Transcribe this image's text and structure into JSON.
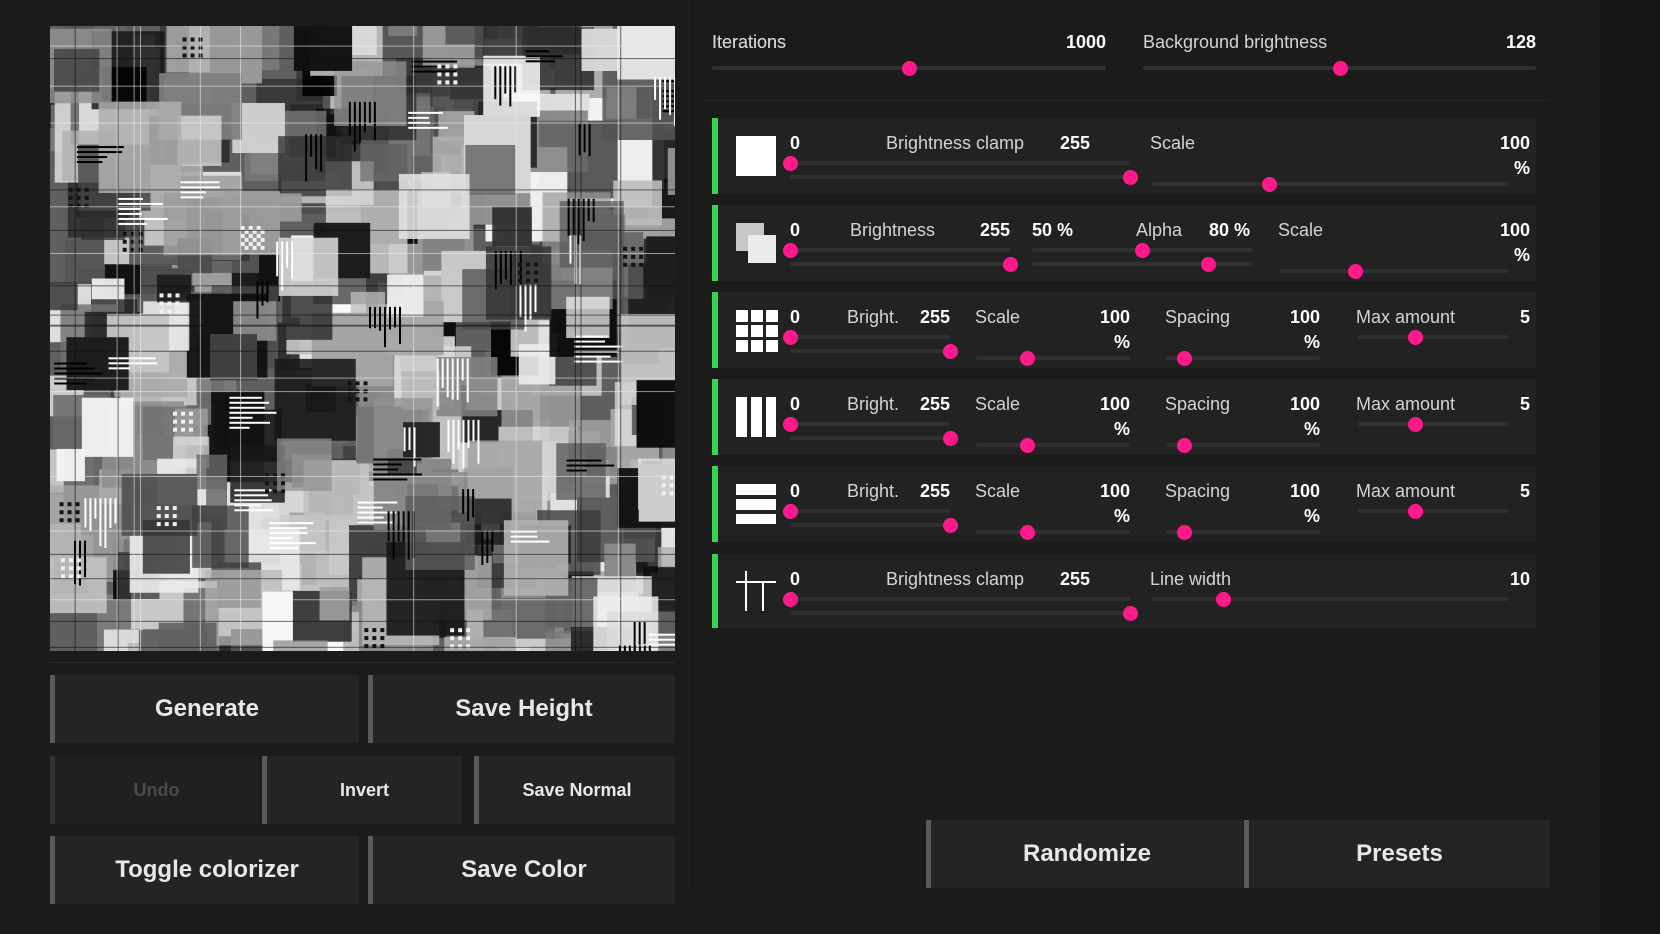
{
  "left_panel": {
    "buttons": {
      "generate": "Generate",
      "save_height": "Save Height",
      "undo": "Undo",
      "invert": "Invert",
      "save_normal": "Save Normal",
      "toggle_colorizer": "Toggle colorizer",
      "save_color": "Save Color"
    }
  },
  "top_settings": {
    "iterations": {
      "label": "Iterations",
      "value": "1000",
      "slider_fraction": 0.5
    },
    "background_brightness": {
      "label": "Background brightness",
      "value": "128",
      "slider_fraction": 0.5
    }
  },
  "layers": {
    "solid": {
      "icon": "filled-square-icon",
      "min": "0",
      "label": "Brightness clamp",
      "max": "255",
      "scale_label": "Scale",
      "scale_value": "100",
      "scale_unit": "%",
      "min_fraction": 0,
      "max_fraction": 1,
      "scale_fraction": 0.33
    },
    "overlap": {
      "icon": "overlapping-squares-icon",
      "min": "0",
      "label": "Brightness",
      "max": "255",
      "alpha_min": "50 %",
      "alpha_label": "Alpha",
      "alpha_max": "80 %",
      "scale_label": "Scale",
      "scale_value": "100",
      "scale_unit": "%",
      "min_fraction": 0,
      "max_fraction": 1,
      "alpha_min_fraction": 0.5,
      "alpha_max_fraction": 0.8,
      "scale_fraction": 0.33
    },
    "dots": {
      "icon": "dot-grid-icon",
      "min": "0",
      "label": "Bright.",
      "max": "255",
      "scale_label": "Scale",
      "scale_value": "100",
      "scale_unit": "%",
      "spacing_label": "Spacing",
      "spacing_value": "100",
      "spacing_unit": "%",
      "max_amount_label": "Max amount",
      "max_amount_value": "5",
      "min_fraction": 0,
      "max_fraction": 1,
      "scale_fraction": 0.33,
      "spacing_fraction": 0.12,
      "max_amount_fraction": 0.38
    },
    "vertical_lines": {
      "icon": "vertical-bars-icon",
      "min": "0",
      "label": "Bright.",
      "max": "255",
      "scale_label": "Scale",
      "scale_value": "100",
      "scale_unit": "%",
      "spacing_label": "Spacing",
      "spacing_value": "100",
      "spacing_unit": "%",
      "max_amount_label": "Max amount",
      "max_amount_value": "5",
      "min_fraction": 0,
      "max_fraction": 1,
      "scale_fraction": 0.33,
      "spacing_fraction": 0.12,
      "max_amount_fraction": 0.38
    },
    "horizontal_lines": {
      "icon": "horizontal-bars-icon",
      "min": "0",
      "label": "Bright.",
      "max": "255",
      "scale_label": "Scale",
      "scale_value": "100",
      "scale_unit": "%",
      "spacing_label": "Spacing",
      "spacing_value": "100",
      "spacing_unit": "%",
      "max_amount_label": "Max amount",
      "max_amount_value": "5",
      "min_fraction": 0,
      "max_fraction": 1,
      "scale_fraction": 0.33,
      "spacing_fraction": 0.12,
      "max_amount_fraction": 0.38
    },
    "grid_lines": {
      "icon": "cross-lines-icon",
      "min": "0",
      "label": "Brightness clamp",
      "max": "255",
      "line_width_label": "Line width",
      "line_width_value": "10",
      "min_fraction": 0,
      "max_fraction": 1,
      "line_width_fraction": 0.2
    }
  },
  "bottom_buttons": {
    "randomize": "Randomize",
    "presets": "Presets"
  },
  "colors": {
    "accent_green": "#39d353",
    "slider_thumb": "#ff1a8c",
    "background": "#1b1b1b",
    "button_bg": "#242424"
  }
}
